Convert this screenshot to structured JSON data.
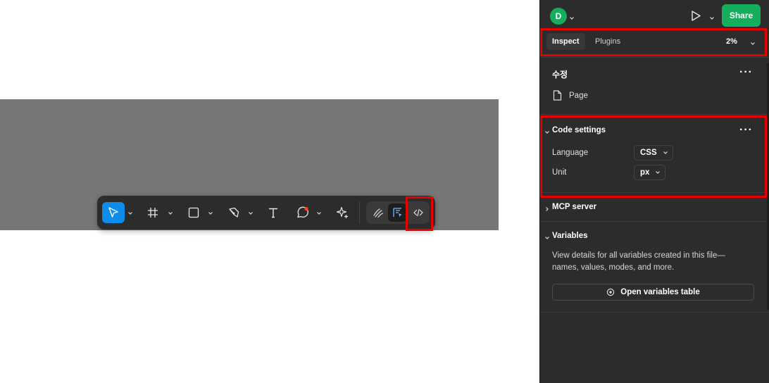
{
  "panel": {
    "avatar_letter": "D",
    "share_label": "Share",
    "tabs": [
      {
        "label": "Inspect",
        "active": true
      },
      {
        "label": "Plugins",
        "active": false
      }
    ],
    "zoom": "2%",
    "page_section": {
      "title": "수정",
      "page_label": "Page"
    },
    "code_settings": {
      "title": "Code settings",
      "language_label": "Language",
      "language_value": "CSS",
      "unit_label": "Unit",
      "unit_value": "px"
    },
    "mcp": {
      "title": "MCP server"
    },
    "variables": {
      "title": "Variables",
      "description": "View details for all variables created in this file—names, values, modes, and more.",
      "button_label": "Open variables table"
    }
  },
  "toolbar": {
    "tools": [
      "move-tool",
      "frame-tool",
      "shape-tool",
      "pen-tool",
      "text-tool",
      "comment-tool",
      "actions-tool",
      "draw-mode",
      "design-mode",
      "dev-mode"
    ]
  },
  "colors": {
    "accent": "#0d8ce9",
    "share": "#14ae5c",
    "highlight": "#e60000",
    "panel_bg": "#2c2c2c"
  }
}
